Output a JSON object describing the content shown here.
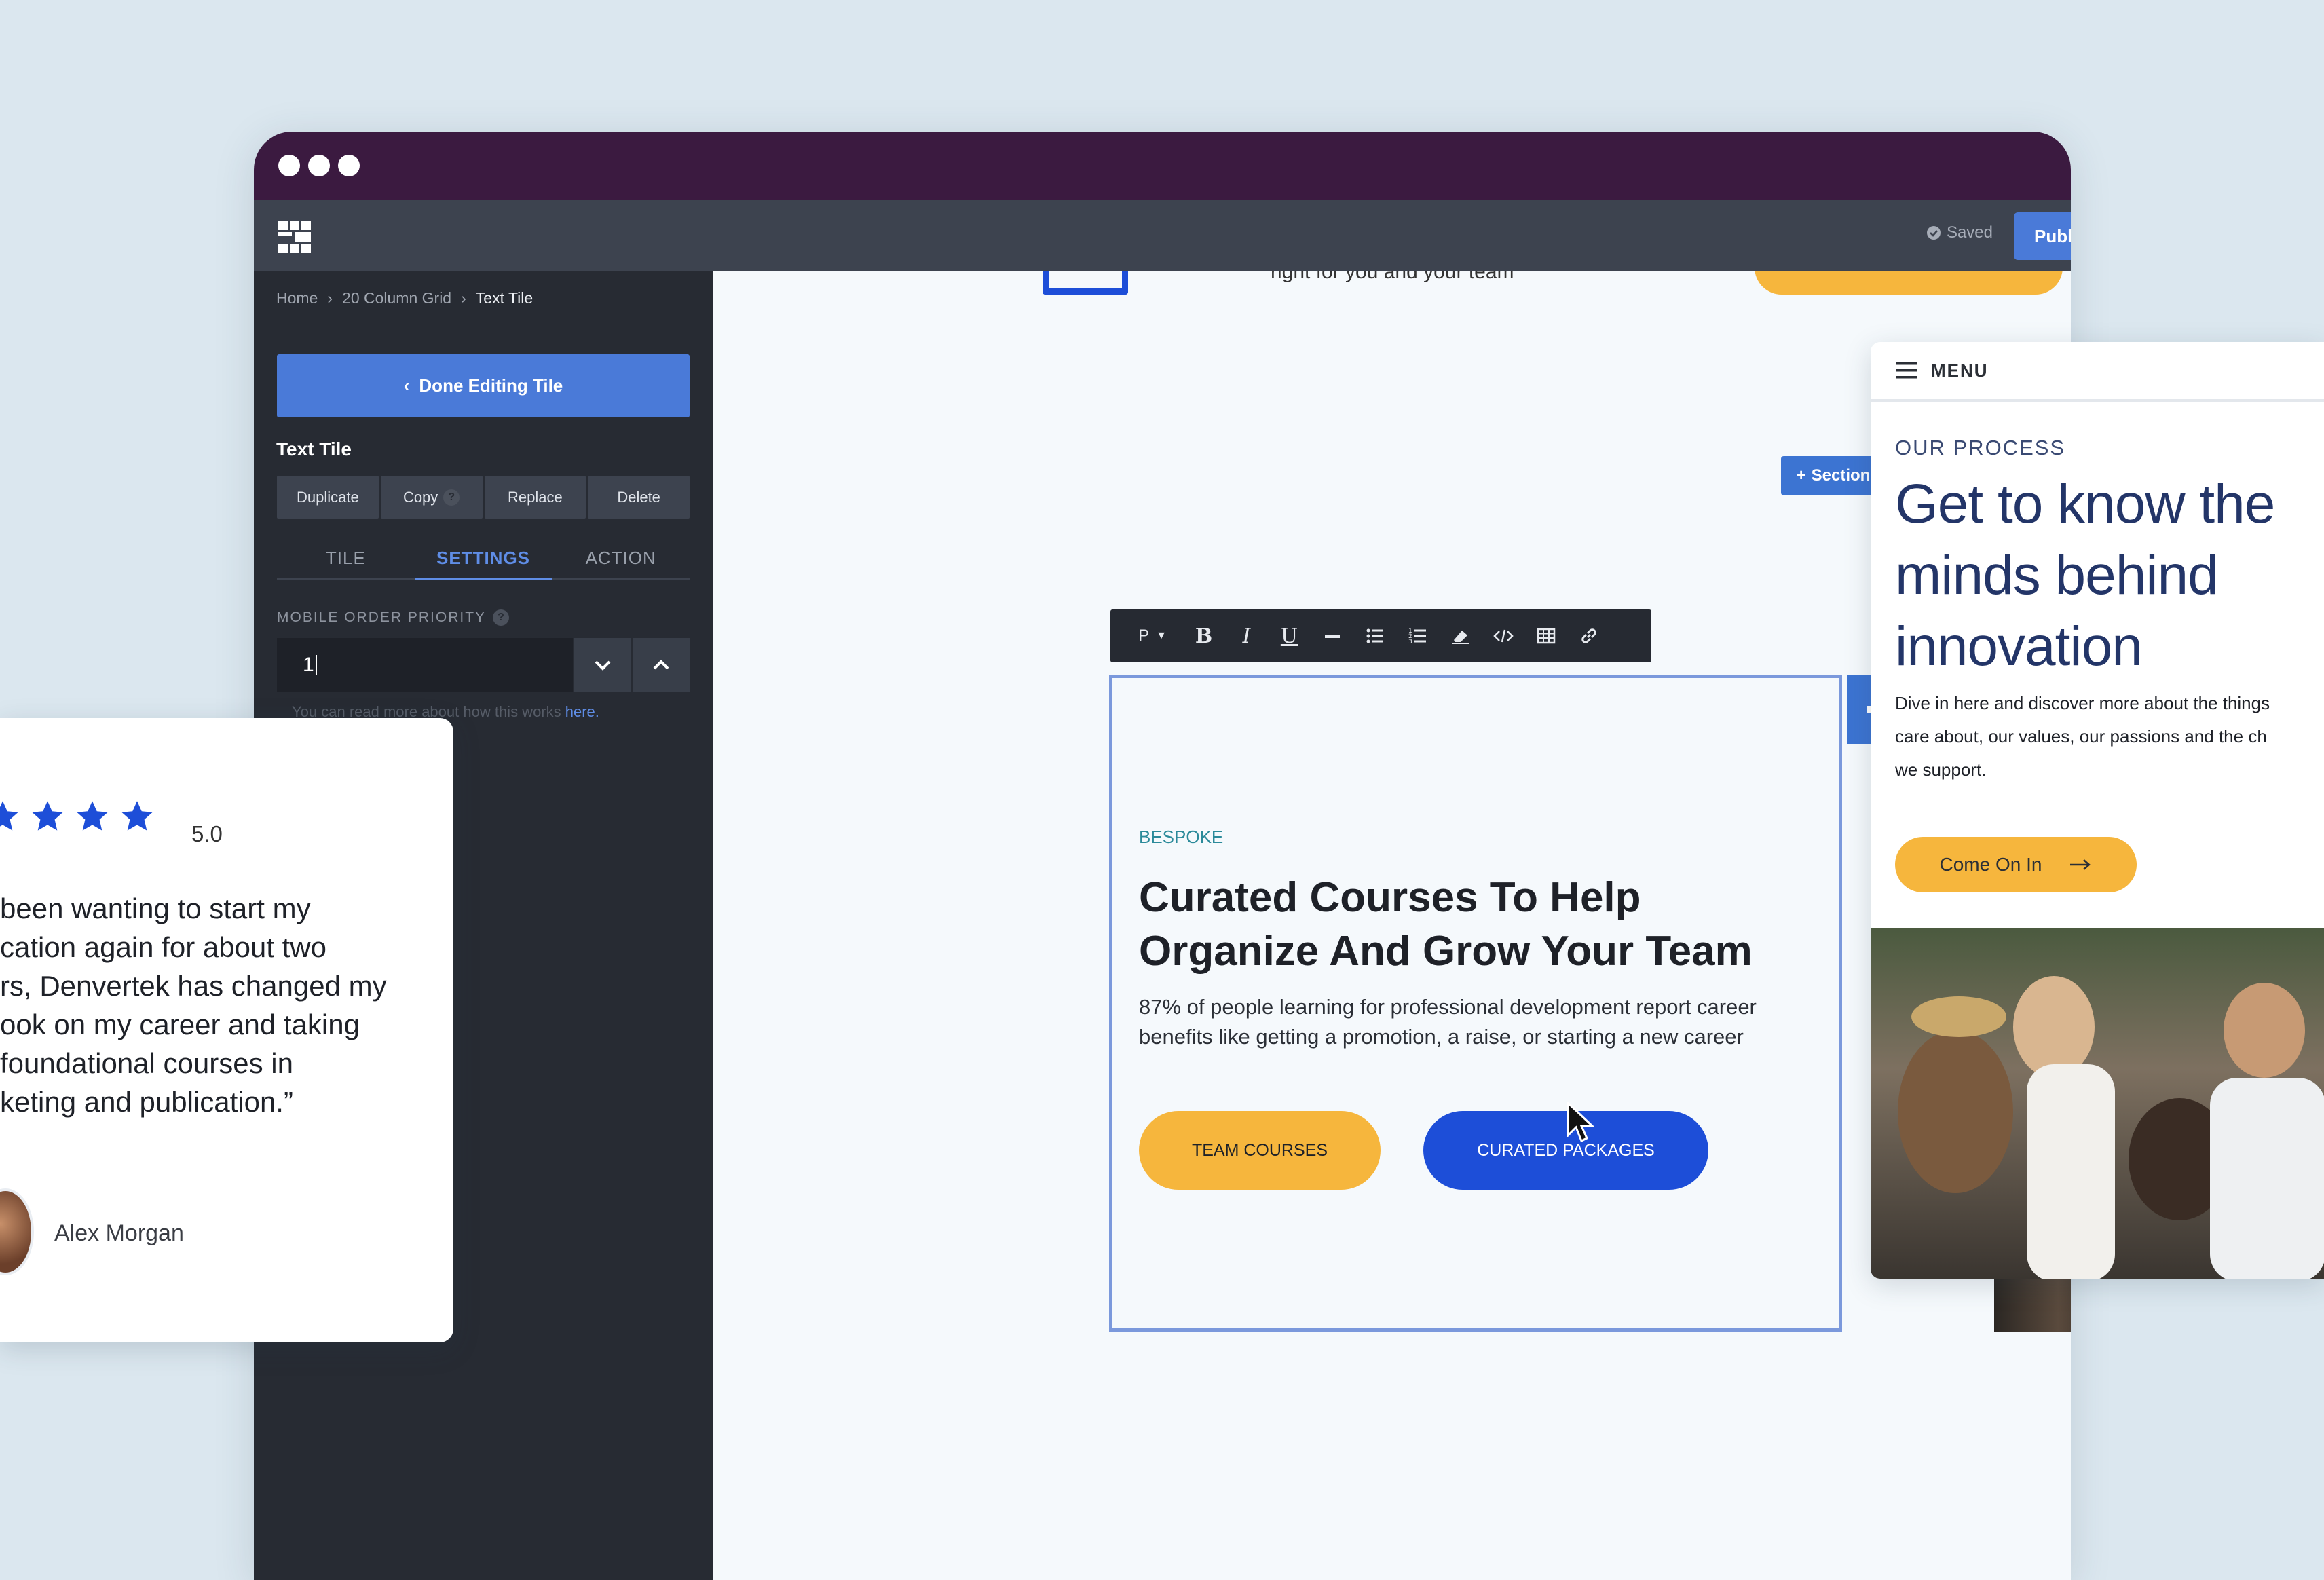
{
  "window": {
    "dots": 3
  },
  "topbar": {
    "saved_label": "Saved",
    "publish_label": "Publish"
  },
  "sidebar": {
    "breadcrumb": [
      "Home",
      "20 Column Grid",
      "Text Tile"
    ],
    "done_button": "Done Editing Tile",
    "tile_heading": "Text Tile",
    "actions": [
      "Duplicate",
      "Copy",
      "Replace",
      "Delete"
    ],
    "tabs": [
      "TILE",
      "SETTINGS",
      "ACTION"
    ],
    "active_tab": "SETTINGS",
    "field_label": "MOBILE ORDER PRIORITY",
    "field_value": "1",
    "hint_text": "You can read more about how this works ",
    "hint_link": "here."
  },
  "canvas": {
    "peek_text": "right for you and your team",
    "section_button": "Section",
    "toolbar": {
      "format": "P",
      "tools": [
        "bold-icon",
        "italic-icon",
        "underline-icon",
        "horizontal-rule-icon",
        "bullet-list-icon",
        "numbered-list-icon",
        "eraser-icon",
        "code-icon",
        "table-icon",
        "link-icon"
      ]
    },
    "tile": {
      "eyebrow": "BESPOKE",
      "heading": "Curated Courses To Help Organize And Grow Your Team",
      "body": "87% of people learning for professional development report career benefits like getting a promotion, a raise, or starting a new career",
      "button_primary": "TEAM COURSES",
      "button_secondary": "CURATED PACKAGES"
    }
  },
  "mobile_preview": {
    "menu_label": "MENU",
    "eyebrow": "OUR PROCESS",
    "heading_lines": [
      "Get to know the",
      "minds behind",
      "innovation"
    ],
    "body_lines": [
      "Dive in here and discover more about the things",
      "care about, our values, our passions and the ch",
      "we support."
    ],
    "cta": "Come On In"
  },
  "review_card": {
    "rating": "5.0",
    "quote_lines": [
      "been wanting to start my",
      "cation again for about two",
      "rs, Denvertek has changed my",
      "ook on my career and taking",
      "foundational courses in",
      "keting and publication.”"
    ],
    "reviewer": "Alex Morgan"
  },
  "colors": {
    "titlebar": "#3b1a40",
    "topbar": "#3d434f",
    "sidebar": "#272b33",
    "accent_blue": "#4a7ad8",
    "brand_blue": "#1d4ed8",
    "brand_yellow": "#f6b63d",
    "navy": "#233568"
  }
}
